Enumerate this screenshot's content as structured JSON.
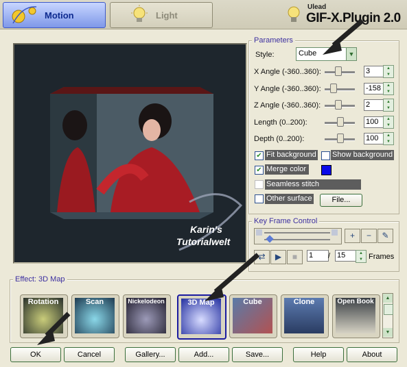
{
  "tabs": {
    "motion": "Motion",
    "light": "Light"
  },
  "brand": {
    "vendor": "Ulead",
    "product": "GIF-X.Plugin 2.0"
  },
  "preview": {
    "watermark_line1": "Karin's",
    "watermark_line2": "Tutorialwelt"
  },
  "parameters": {
    "title": "Parameters",
    "style_label": "Style:",
    "style_value": "Cube",
    "x_label": "X Angle (-360..360):",
    "x_value": "3",
    "y_label": "Y Angle (-360..360):",
    "y_value": "-158",
    "z_label": "Z Angle (-360..360):",
    "z_value": "2",
    "length_label": "Length (0..200):",
    "length_value": "100",
    "depth_label": "Depth (0..200):",
    "depth_value": "100",
    "fit_background": "Fit background",
    "show_background": "Show background",
    "merge_color": "Merge color",
    "merge_color_hex": "#0a0ae8",
    "seamless_stitch": "Seamless stitch",
    "other_surface": "Other surface",
    "file_button": "File..."
  },
  "keyframe": {
    "title": "Key Frame Control",
    "current_frame": "1",
    "separator": "/",
    "total_frames": "15",
    "frames_label": "Frames"
  },
  "effects": {
    "title": "Effect: 3D Map",
    "items": [
      "Rotation",
      "Scan",
      "Nickelodeon",
      "3D Map",
      "Cube",
      "Clone",
      "Open Book"
    ],
    "selected": "3D Map"
  },
  "buttons": {
    "ok": "OK",
    "cancel": "Cancel",
    "gallery": "Gallery...",
    "add": "Add...",
    "save": "Save...",
    "help": "Help",
    "about": "About"
  }
}
